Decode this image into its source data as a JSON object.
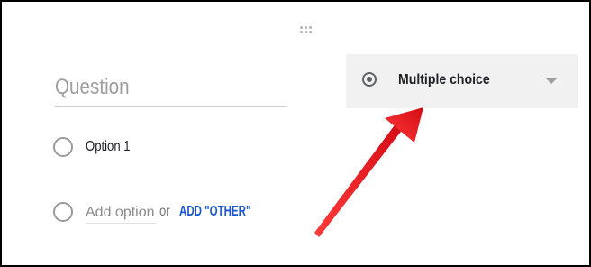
{
  "question": {
    "placeholder": "Question"
  },
  "question_type": {
    "selected_label": "Multiple choice",
    "icon": "radio-button-checked-icon",
    "dropdown_icon": "caret-down-icon"
  },
  "options": [
    {
      "label": "Option 1",
      "icon": "radio-button-unchecked-icon"
    }
  ],
  "add_option": {
    "placeholder": "Add option",
    "or_text": "or",
    "add_other_label": "ADD \"OTHER\""
  },
  "colors": {
    "annotation_arrow": "#e8101a",
    "link": "#1a56d6",
    "select_background": "#f1f1f1"
  }
}
